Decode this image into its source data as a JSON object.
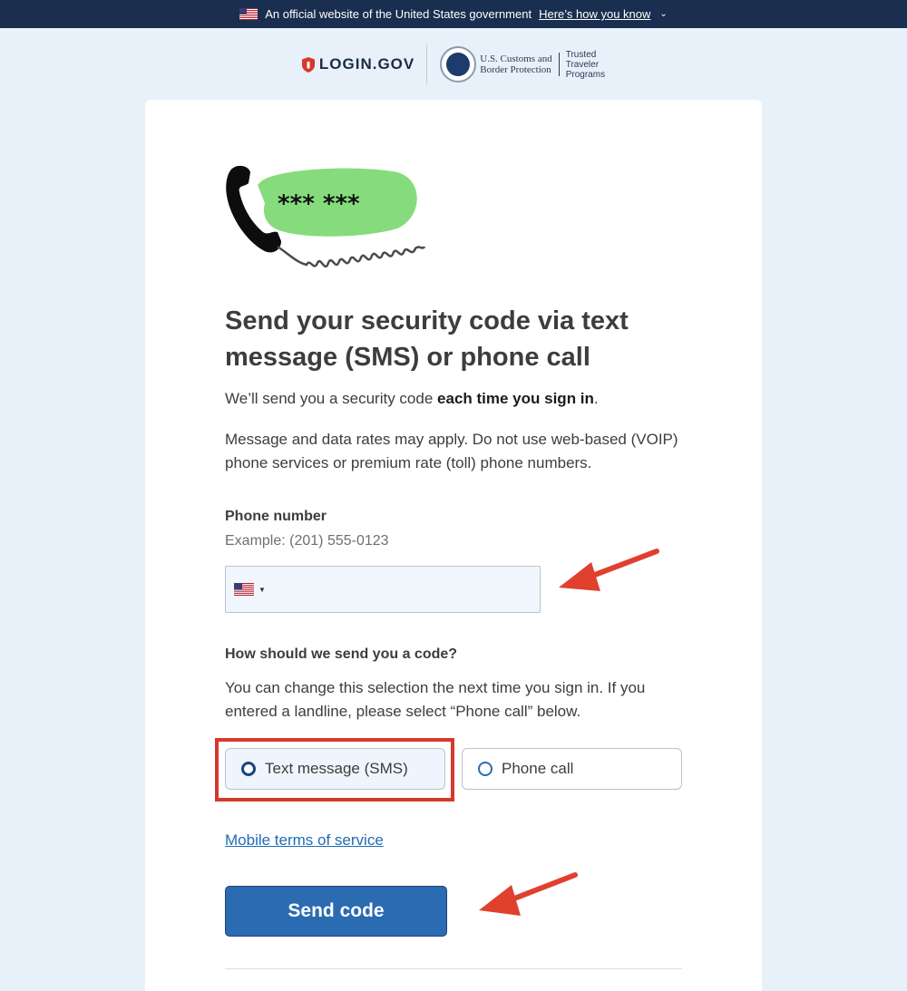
{
  "banner": {
    "text": "An official website of the United States government",
    "link": "Here’s how you know"
  },
  "header": {
    "logo_text": "LOGIN.GOV",
    "agency_line1": "U.S. Customs and",
    "agency_line2": "Border Protection",
    "program_line1": "Trusted",
    "program_line2": "Traveler",
    "program_line3": "Programs"
  },
  "illustration": {
    "code_text": "*** ***"
  },
  "main": {
    "title": "Send your security code via text message (SMS) or phone call",
    "intro_prefix": "We’ll send you a security code ",
    "intro_bold": "each time you sign in",
    "intro_suffix": ".",
    "rates_text": "Message and data rates may apply. Do not use web-based (VOIP) phone services or premium rate (toll) phone numbers."
  },
  "phone": {
    "label": "Phone number",
    "hint": "Example: (201) 555-0123",
    "value": "",
    "country": "US"
  },
  "delivery": {
    "label": "How should we send you a code?",
    "hint": "You can change this selection the next time you sign in. If you entered a landline, please select “Phone call” below.",
    "options": [
      {
        "label": "Text message (SMS)",
        "selected": true
      },
      {
        "label": "Phone call",
        "selected": false
      }
    ]
  },
  "links": {
    "terms": "Mobile terms of service"
  },
  "actions": {
    "send_label": "Send code"
  },
  "colors": {
    "primary": "#2b6bb2",
    "annotation": "#d6392b",
    "banner_bg": "#1a2e4f",
    "page_bg": "#e8f1fa"
  }
}
